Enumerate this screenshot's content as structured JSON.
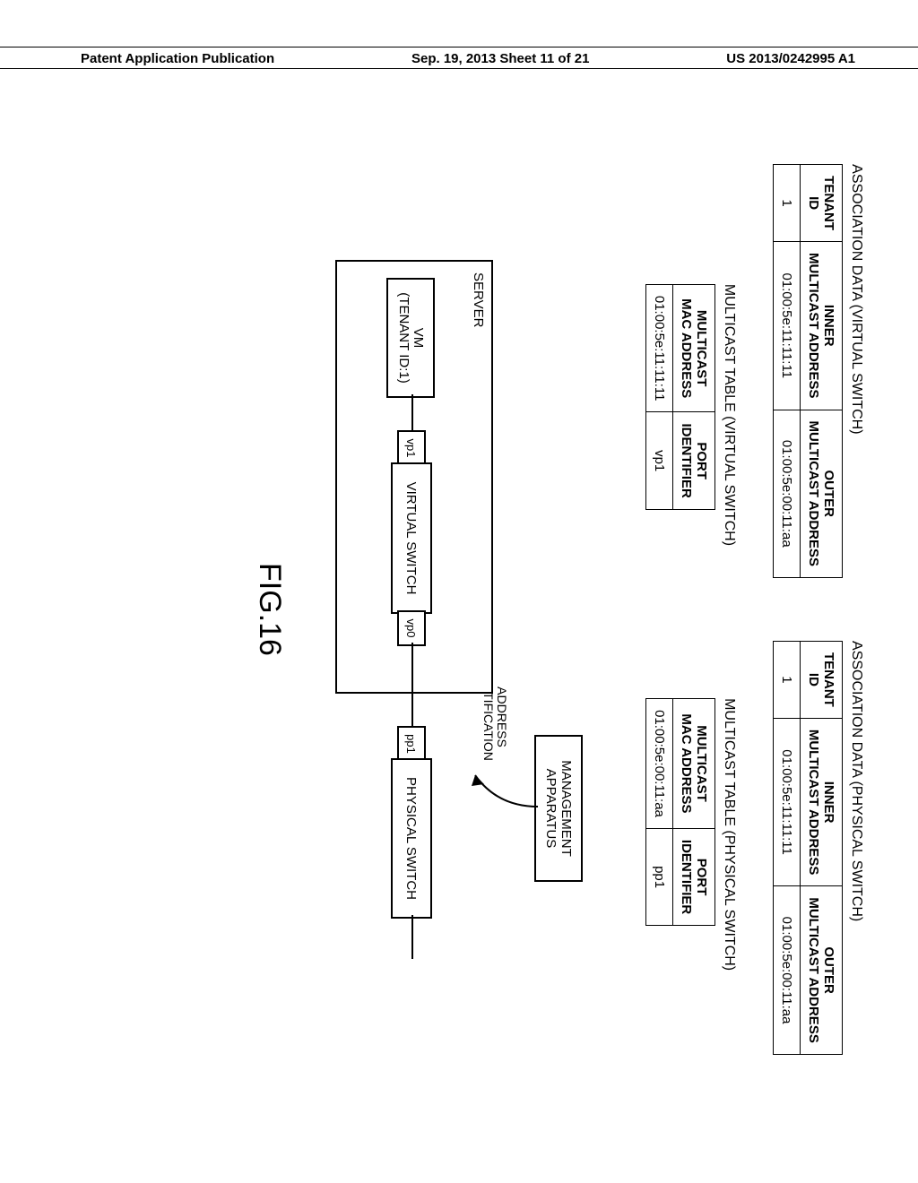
{
  "header": {
    "left": "Patent Application Publication",
    "center": "Sep. 19, 2013  Sheet 11 of 21",
    "right": "US 2013/0242995 A1"
  },
  "tables": {
    "assoc_virtual": {
      "caption": "ASSOCIATION DATA (VIRTUAL SWITCH)",
      "headers": {
        "c1a": "TENANT",
        "c1b": "ID",
        "c2a": "INNER",
        "c2b": "MULTICAST ADDRESS",
        "c3a": "OUTER",
        "c3b": "MULTICAST ADDRESS"
      },
      "row": {
        "c1": "1",
        "c2": "01:00:5e:11:11:11",
        "c3": "01:00:5e:00:11:aa"
      }
    },
    "assoc_physical": {
      "caption": "ASSOCIATION DATA (PHYSICAL SWITCH)",
      "headers": {
        "c1a": "TENANT",
        "c1b": "ID",
        "c2a": "INNER",
        "c2b": "MULTICAST ADDRESS",
        "c3a": "OUTER",
        "c3b": "MULTICAST ADDRESS"
      },
      "row": {
        "c1": "1",
        "c2": "01:00:5e:11:11:11",
        "c3": "01:00:5e:00:11:aa"
      }
    },
    "mcast_virtual": {
      "caption": "MULTICAST TABLE (VIRTUAL SWITCH)",
      "headers": {
        "c1a": "MULTICAST",
        "c1b": "MAC ADDRESS",
        "c2a": "PORT",
        "c2b": "IDENTIFIER"
      },
      "row": {
        "c1": "01:00:5e:11:11:11",
        "c2": "vp1"
      }
    },
    "mcast_physical": {
      "caption": "MULTICAST TABLE (PHYSICAL SWITCH)",
      "headers": {
        "c1a": "MULTICAST",
        "c1b": "MAC ADDRESS",
        "c2a": "PORT",
        "c2b": "IDENTIFIER"
      },
      "row": {
        "c1": "01:00:5e:00:11:aa",
        "c2": "pp1"
      }
    }
  },
  "diagram": {
    "server": "SERVER",
    "vm_l1": "VM",
    "vm_l2": "(TENANT ID:1)",
    "vp1": "vp1",
    "virtual_switch": "VIRTUAL SWITCH",
    "vp0": "vp0",
    "pp1": "pp1",
    "physical_switch": "PHYSICAL SWITCH",
    "mgmt_l1": "MANAGEMENT",
    "mgmt_l2": "APPARATUS",
    "addr_l1": "ADDRESS",
    "addr_l2": "NOTIFICATION"
  },
  "figure_label": "FIG.16"
}
